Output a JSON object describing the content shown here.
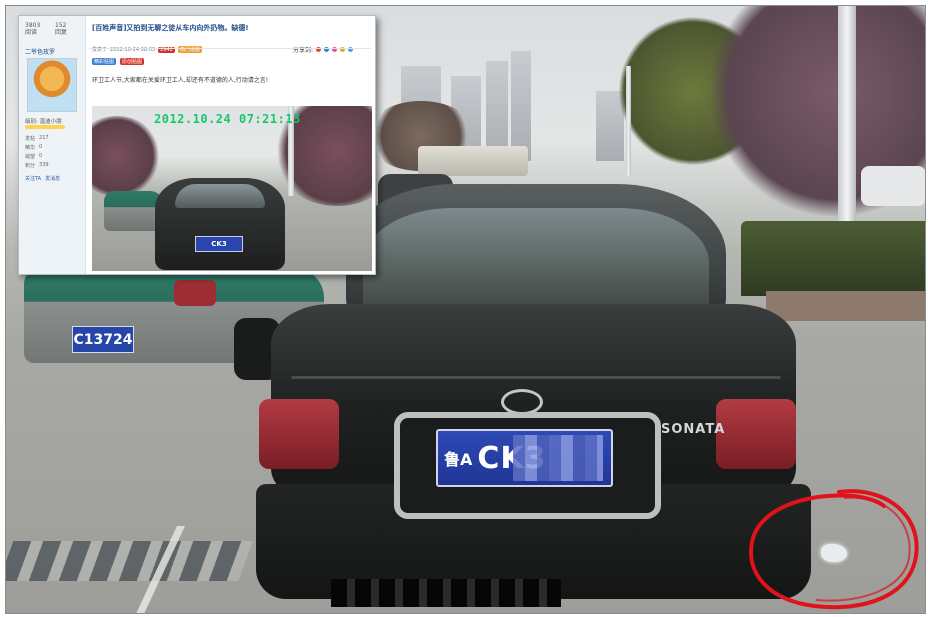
{
  "inset": {
    "title": "[百姓声音]又拍到无聊之徒从车内向外扔物。缺德!",
    "sidebar": {
      "stats": [
        {
          "value": "3803",
          "label": "阅读"
        },
        {
          "value": "152",
          "label": "回复"
        }
      ],
      "user_name": "二爷色玫罗",
      "level_label": "级别: 温迪小朋",
      "rows": [
        {
          "label": "发帖",
          "value": "217"
        },
        {
          "label": "精华",
          "value": "0"
        },
        {
          "label": "威望",
          "value": "0"
        },
        {
          "label": "积分",
          "value": "339"
        }
      ],
      "actions": [
        "关注TA",
        "发消息"
      ]
    },
    "meta": {
      "author_prefix": "发表于",
      "date": "2012-10-24 08:03",
      "count_badge": "只看楼主",
      "views": "2942",
      "hot_label": "热门话题",
      "share_label": "分享到:",
      "more": "只看楼主"
    },
    "tags": [
      "精彩贴图",
      "原创贴图"
    ],
    "body_text": "环卫工人节,大家都在关爱环卫工人,却还有不道德的人,行动请之言!",
    "photo": {
      "timestamp": "2012.10.24 07:21:13",
      "plate": "CK3"
    }
  },
  "photo": {
    "main_plate_province": "鲁A",
    "main_plate_number": "CK3",
    "car_badge": "SONATA",
    "taxi_plate": "C13724"
  },
  "colors": {
    "annotation_red": "#e0121b",
    "timestamp_green": "#18c96a",
    "plate_blue": "#2846ad"
  }
}
